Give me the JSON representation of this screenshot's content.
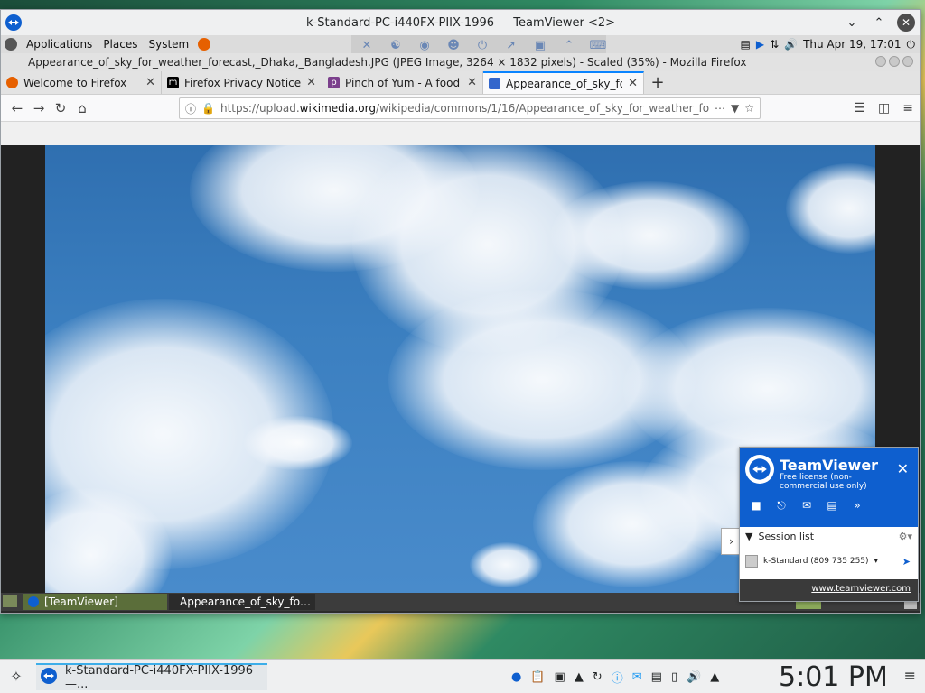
{
  "teamviewer_window": {
    "title": "k-Standard-PC-i440FX-PIIX-1996 — TeamViewer <2>",
    "buttons": [
      "chevron-down",
      "chevron-up",
      "close"
    ]
  },
  "remote_top_panel": {
    "menus": [
      "Applications",
      "Places",
      "System"
    ],
    "datetime": "Thu Apr 19, 17:01"
  },
  "firefox": {
    "window_title": "Appearance_of_sky_for_weather_forecast,_Dhaka,_Bangladesh.JPG (JPEG Image, 3264 × 1832 pixels) - Scaled (35%) - Mozilla Firefox",
    "tabs": [
      {
        "label": "Welcome to Firefox",
        "icon": "firefox-icon",
        "color": "#e66000"
      },
      {
        "label": "Firefox Privacy Notice —",
        "icon": "mozilla-m-icon",
        "color": "#000000"
      },
      {
        "label": "Pinch of Yum - A food bl",
        "icon": "p-icon",
        "color": "#7b3f8c"
      },
      {
        "label": "Appearance_of_sky_for",
        "icon": "wikimedia-icon",
        "color": "#3366cc",
        "active": true
      }
    ],
    "url_prefix": "https://upload.",
    "url_domain": "wikimedia.org",
    "url_path": "/wikipedia/commons/1/16/Appearance_of_sky_for_weather_for"
  },
  "remote_taskbar": {
    "items": [
      "[TeamViewer]",
      "Appearance_of_sky_fo…"
    ]
  },
  "tv_panel": {
    "brand": "TeamViewer",
    "license": "Free license (non-commercial use only)",
    "session_header": "Session list",
    "session_item": "k-Standard (809 735 255)",
    "footer_link": "www.teamviewer.com"
  },
  "local_taskbar": {
    "task_label": "k-Standard-PC-i440FX-PIIX-1996 —...",
    "clock": "5:01 PM"
  },
  "colors": {
    "accent": "#0a84ff",
    "teamviewer_blue": "#0e5fcf"
  }
}
